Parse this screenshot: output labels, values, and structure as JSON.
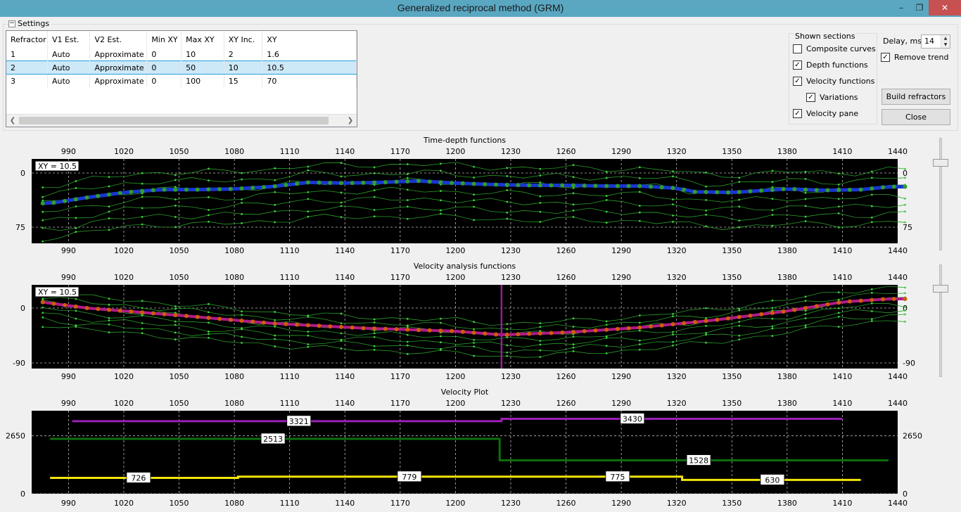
{
  "window": {
    "title": "Generalized reciprocal method (GRM)"
  },
  "settings": {
    "label": "Settings"
  },
  "table": {
    "headers": [
      "Refractor",
      "V1 Est.",
      "V2 Est.",
      "Min XY",
      "Max XY",
      "XY Inc.",
      "XY"
    ],
    "rows": [
      [
        "1",
        "Auto",
        "Approximate",
        "0",
        "10",
        "2",
        "1.6"
      ],
      [
        "2",
        "Auto",
        "Approximate",
        "0",
        "50",
        "10",
        "10.5"
      ],
      [
        "3",
        "Auto",
        "Approximate",
        "0",
        "100",
        "15",
        "70"
      ]
    ],
    "selected_row": 1
  },
  "shown_sections": {
    "title": "Shown sections",
    "items": [
      {
        "label": "Composite curves",
        "checked": false
      },
      {
        "label": "Depth functions",
        "checked": true
      },
      {
        "label": "Velocity functions",
        "checked": true
      },
      {
        "label": "Variations",
        "checked": true
      },
      {
        "label": "Velocity pane",
        "checked": true
      }
    ]
  },
  "delay": {
    "label": "Delay, ms",
    "value": "14"
  },
  "remove_trend": {
    "label": "Remove trend",
    "checked": true
  },
  "buttons": {
    "build": "Build refractors",
    "close": "Close"
  },
  "chart_data": [
    {
      "type": "line",
      "title": "Time-depth functions",
      "badge": "XY = 10.5",
      "x_ticks": [
        "990",
        "1020",
        "1050",
        "1080",
        "1110",
        "1140",
        "1170",
        "1200",
        "1230",
        "1260",
        "1290",
        "1320",
        "1350",
        "1380",
        "1410",
        "1440"
      ],
      "y_ticks": [
        "0",
        "75"
      ],
      "xlim": [
        970,
        1440
      ],
      "ylim": [
        0,
        75
      ],
      "colors": {
        "main": "#1a35d0",
        "main_markers": "#2e9e2e",
        "variations": "#2a9a2a",
        "background": "#000000"
      },
      "main": {
        "x": [
          980,
          1000,
          1020,
          1040,
          1060,
          1080,
          1100,
          1120,
          1140,
          1160,
          1180,
          1200,
          1220,
          1240,
          1260,
          1280,
          1300,
          1320,
          1330,
          1350,
          1380,
          1400,
          1420,
          1435
        ],
        "y": [
          42,
          34,
          27,
          23,
          23,
          22,
          19,
          13,
          14,
          13,
          11,
          14,
          16,
          17,
          17,
          18,
          18,
          21,
          26,
          27,
          22,
          24,
          23,
          19
        ]
      }
    },
    {
      "type": "line",
      "title": "Velocity analysis functions",
      "badge": "XY = 10.5",
      "x_ticks": [
        "990",
        "1020",
        "1050",
        "1080",
        "1110",
        "1140",
        "1170",
        "1200",
        "1230",
        "1260",
        "1290",
        "1320",
        "1350",
        "1380",
        "1410",
        "1440"
      ],
      "y_ticks": [
        "0",
        "-90"
      ],
      "xlim": [
        970,
        1440
      ],
      "ylim": [
        -90,
        0
      ],
      "marker_x": 1225,
      "colors": {
        "main": "#b01a8a",
        "main_markers": "#d05a10",
        "variations": "#2a9a2a",
        "marker": "#9a1a9a"
      },
      "main": {
        "x": [
          975,
          1000,
          1050,
          1100,
          1150,
          1200,
          1225,
          1260,
          1300,
          1340,
          1380,
          1410,
          1435
        ],
        "y": [
          10,
          0,
          -12,
          -25,
          -33,
          -38,
          -44,
          -40,
          -32,
          -20,
          -5,
          10,
          15
        ]
      }
    },
    {
      "type": "line",
      "title": "Velocity Plot",
      "x_ticks": [
        "990",
        "1020",
        "1050",
        "1080",
        "1110",
        "1140",
        "1170",
        "1200",
        "1230",
        "1260",
        "1290",
        "1320",
        "1350",
        "1380",
        "1410",
        "1440"
      ],
      "y_ticks": [
        "0",
        "2650"
      ],
      "xlim": [
        970,
        1440
      ],
      "ylim": [
        0,
        3800
      ],
      "series": [
        {
          "color": "#9b1fb8",
          "steps": [
            [
              992,
              1225,
              3321
            ],
            [
              1225,
              1410,
              3430
            ]
          ],
          "labels": [
            {
              "x": 1115,
              "text": "3321"
            },
            {
              "x": 1296,
              "text": "3430"
            }
          ]
        },
        {
          "color": "#0e6e0e",
          "steps": [
            [
              980,
              1224,
              2513
            ],
            [
              1224,
              1435,
              1528
            ]
          ],
          "labels": [
            {
              "x": 1101,
              "text": "2513"
            },
            {
              "x": 1332,
              "text": "1528"
            }
          ]
        },
        {
          "color": "#f2e60a",
          "steps": [
            [
              980,
              1082,
              726
            ],
            [
              1082,
              1323,
              779
            ],
            [
              1323,
              1420,
              630
            ]
          ],
          "labels": [
            {
              "x": 1028,
              "text": "726"
            },
            {
              "x": 1175,
              "text": "779"
            },
            {
              "x": 1288,
              "text": "775"
            },
            {
              "x": 1372,
              "text": "630"
            }
          ]
        }
      ]
    }
  ]
}
